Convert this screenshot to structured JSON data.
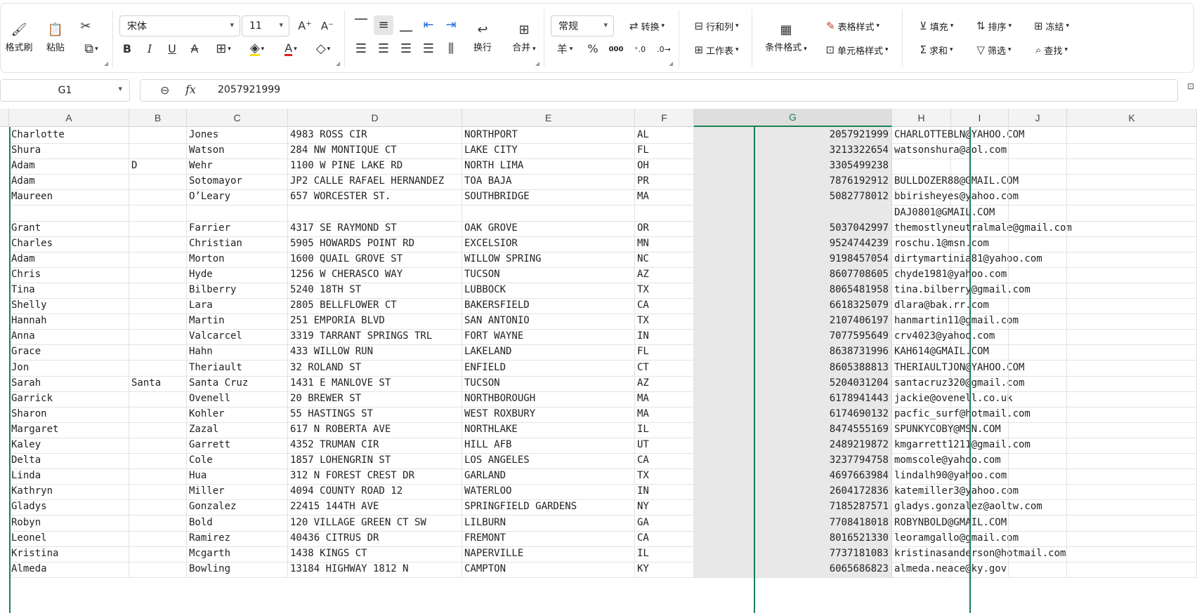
{
  "ribbon": {
    "format_painter": "格式刷",
    "paste": "粘贴",
    "font_name": "宋体",
    "font_size": "11",
    "wrap": "换行",
    "merge": "合并",
    "number_format": "常规",
    "convert": "转换",
    "rows_cols": "行和列",
    "worksheet": "工作表",
    "cond_format": "条件格式",
    "table_style": "表格样式",
    "cell_style": "单元格样式",
    "fill": "填充",
    "sort": "排序",
    "freeze": "冻结",
    "sum": "求和",
    "filter": "筛选",
    "find": "查找",
    "percent": "%",
    "yen": "羊",
    "thousands": "000"
  },
  "formula_bar": {
    "cell_ref": "G1",
    "fx": "fx",
    "value": "2057921999"
  },
  "columns": [
    "A",
    "B",
    "C",
    "D",
    "E",
    "F",
    "G",
    "H",
    "I",
    "J",
    "K"
  ],
  "selected_column": "G",
  "rows": [
    [
      "Charlotte",
      "",
      "Jones",
      "4983 ROSS CIR",
      "NORTHPORT",
      "AL",
      "2057921999",
      "CHARLOTTEBLN@YAHOO.COM"
    ],
    [
      "Shura",
      "",
      "Watson",
      "284 NW MONTIQUE CT",
      "LAKE CITY",
      "FL",
      "3213322654",
      "watsonshura@aol.com"
    ],
    [
      "Adam",
      "D",
      "Wehr",
      "1100 W PINE LAKE RD",
      "NORTH LIMA",
      "OH",
      "3305499238",
      ""
    ],
    [
      "Adam",
      "",
      "Sotomayor",
      "JP2 CALLE RAFAEL HERNANDEZ",
      "TOA BAJA",
      "PR",
      "7876192912",
      "BULLDOZER88@GMAIL.COM"
    ],
    [
      "Maureen",
      "",
      "O’Leary",
      "657 WORCESTER ST.",
      "SOUTHBRIDGE",
      "MA",
      "5082778012",
      "bbirisheyes@yahoo.com"
    ],
    [
      "",
      "",
      "",
      "",
      "",
      "",
      "",
      "DAJ0801@GMAIL.COM"
    ],
    [
      "Grant",
      "",
      "Farrier",
      "4317 SE RAYMOND ST",
      "OAK GROVE",
      "OR",
      "5037042997",
      "themostlyneutralmale@gmail.com"
    ],
    [
      "Charles",
      "",
      "Christian",
      "5905 HOWARDS POINT RD",
      "EXCELSIOR",
      "MN",
      "9524744239",
      "roschu.1@msn.com"
    ],
    [
      "Adam",
      "",
      "Morton",
      "1600 QUAIL GROVE ST",
      "WILLOW SPRING",
      "NC",
      "9198457054",
      "dirtymartinia81@yahoo.com"
    ],
    [
      "Chris",
      "",
      "Hyde",
      "1256 W CHERASCO WAY",
      "TUCSON",
      "AZ",
      "8607708605",
      "chyde1981@yahoo.com"
    ],
    [
      "Tina",
      "",
      "Bilberry",
      "5240 18TH ST",
      "LUBBOCK",
      "TX",
      "8065481958",
      "tina.bilberry@gmail.com"
    ],
    [
      "Shelly",
      "",
      "Lara",
      "2805 BELLFLOWER CT",
      "BAKERSFIELD",
      "CA",
      "6618325079",
      "dlara@bak.rr.com"
    ],
    [
      "Hannah",
      "",
      "Martin",
      "251 EMPORIA BLVD",
      "SAN ANTONIO",
      "TX",
      "2107406197",
      "hanmartin11@gmail.com"
    ],
    [
      "Anna",
      "",
      "Valcarcel",
      "3319 TARRANT SPRINGS TRL",
      "FORT WAYNE",
      "IN",
      "7077595649",
      "crv4023@yahoo.com"
    ],
    [
      "Grace",
      "",
      "Hahn",
      "433 WILLOW RUN",
      "LAKELAND",
      "FL",
      "8638731996",
      "KAH614@GMAIL.COM"
    ],
    [
      "Jon",
      "",
      "Theriault",
      "32 ROLAND ST",
      "ENFIELD",
      "CT",
      "8605388813",
      "THERIAULTJON@YAHOO.COM"
    ],
    [
      "Sarah",
      "Santa",
      "Santa Cruz",
      "1431 E MANLOVE ST",
      "TUCSON",
      "AZ",
      "5204031204",
      "santacruz320@gmail.com"
    ],
    [
      "Garrick",
      "",
      "Ovenell",
      "20 BREWER ST",
      "NORTHBOROUGH",
      "MA",
      "6178941443",
      "jackie@ovenell.co.uk"
    ],
    [
      "Sharon",
      "",
      "Kohler",
      "55 HASTINGS ST",
      "WEST ROXBURY",
      "MA",
      "6174690132",
      "pacfic_surf@hotmail.com"
    ],
    [
      "Margaret",
      "",
      "Zazal",
      "617 N ROBERTA AVE",
      "NORTHLAKE",
      "IL",
      "8474555169",
      "SPUNKYCOBY@MSN.COM"
    ],
    [
      "Kaley",
      "",
      "Garrett",
      "4352 TRUMAN CIR",
      "HILL AFB",
      "UT",
      "2489219872",
      "kmgarrett1211@gmail.com"
    ],
    [
      "Delta",
      "",
      "Cole",
      "1857 LOHENGRIN ST",
      "LOS ANGELES",
      "CA",
      "3237794758",
      "momscole@yahoo.com"
    ],
    [
      "Linda",
      "",
      "Hua",
      "312 N FOREST CREST DR",
      "GARLAND",
      "TX",
      "4697663984",
      "lindalh90@yahoo.com"
    ],
    [
      "Kathryn",
      "",
      "Miller",
      "4094 COUNTY ROAD 12",
      "WATERLOO",
      "IN",
      "2604172836",
      "katemiller3@yahoo.com"
    ],
    [
      "Gladys",
      "",
      "Gonzalez",
      "22415 144TH AVE",
      "SPRINGFIELD GARDENS",
      "NY",
      "7185287571",
      "gladys.gonzalez@aoltw.com"
    ],
    [
      "Robyn",
      "",
      "Bold",
      "120 VILLAGE GREEN CT SW",
      "LILBURN",
      "GA",
      "7708418018",
      "ROBYNBOLD@GMAIL.COM"
    ],
    [
      "Leonel",
      "",
      "Ramirez",
      "40436 CITRUS DR",
      "FREMONT",
      "CA",
      "8016521330",
      "leoramgallo@gmail.com"
    ],
    [
      "Kristina",
      "",
      "Mcgarth",
      "1438 KINGS CT",
      "NAPERVILLE",
      "IL",
      "7737181083",
      "kristinasanderson@hotmail.com"
    ],
    [
      "Almeda",
      "",
      "Bowling",
      "13184 HIGHWAY 1812 N",
      "CAMPTON",
      "KY",
      "6065686823",
      "almeda.neace@ky.gov"
    ]
  ],
  "colors": {
    "accent": "#1a7f52",
    "selected_fill": "#e8e8e8"
  }
}
